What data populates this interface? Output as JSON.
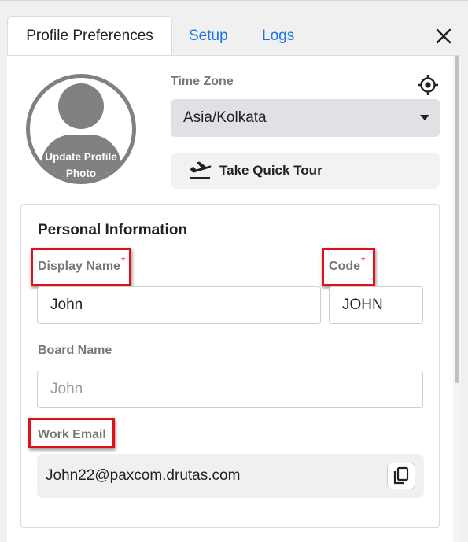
{
  "tabs": [
    {
      "label": "Profile Preferences"
    },
    {
      "label": "Setup"
    },
    {
      "label": "Logs"
    }
  ],
  "avatar": {
    "label": "Update Profile Photo"
  },
  "timezone": {
    "label": "Time Zone",
    "value": "Asia/Kolkata"
  },
  "tour": {
    "label": "Take Quick Tour"
  },
  "personal": {
    "title": "Personal Information",
    "display_name": {
      "label": "Display Name",
      "value": "John",
      "required": "*"
    },
    "code": {
      "label": "Code",
      "value": "JOHN",
      "required": "*"
    },
    "board_name": {
      "label": "Board Name",
      "placeholder": "John"
    },
    "work_email": {
      "label": "Work Email",
      "value": "John22@paxcom.drutas.com"
    }
  },
  "colors": {
    "link": "#1a73e8",
    "highlight": "#e0101a",
    "required": "#e53935"
  }
}
